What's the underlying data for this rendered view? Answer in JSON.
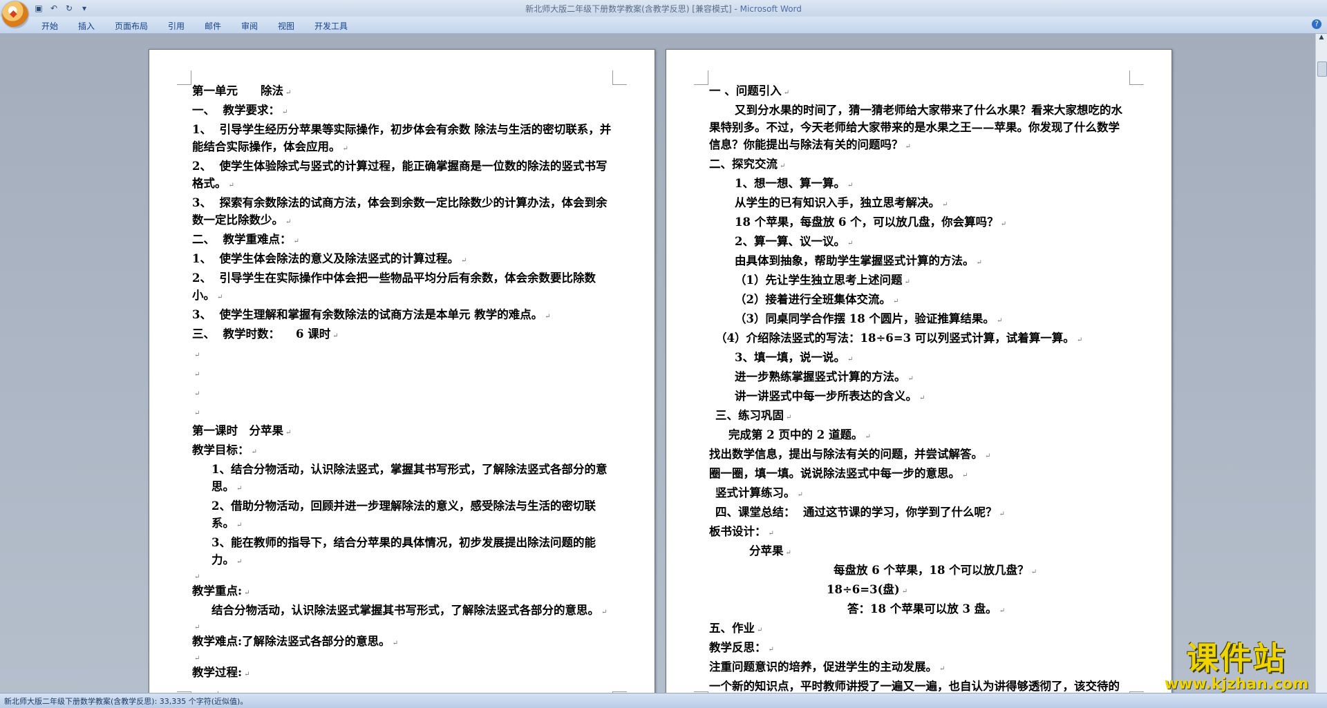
{
  "window": {
    "title": "新北师大版二年级下册数学教案(含教学反思) [兼容模式] - ",
    "app_name": "Microsoft Word"
  },
  "ribbon": {
    "tabs": [
      "开始",
      "插入",
      "页面布局",
      "引用",
      "邮件",
      "审阅",
      "视图",
      "开发工具"
    ]
  },
  "status": {
    "text": "新北师大版二年级下册数学教案(含教学反思): 33,335 个字符(近似值)。"
  },
  "watermark": {
    "text": "课件站",
    "url": "www.kjzhan.com"
  },
  "page1": {
    "lines": [
      "第一单元　　除法",
      "一、  教学要求：",
      "1、  引导学生经历分苹果等实际操作，初步体会有余数 除法与生活的密切联系，并能结合实际操作，体会应用。",
      "2、  使学生体验除式与竖式的计算过程，能正确掌握商是一位数的除法的竖式书写格式。",
      "3、  探索有余数除法的试商方法，体会到余数一定比除数少的计算办法，体会到余数一定比除数少。",
      "二、  教学重难点：",
      "1、  使学生体会除法的意义及除法竖式的计算过程。",
      "2、  引导学生在实际操作中体会把一些物品平均分后有余数，体会余数要比除数小。",
      "3、  使学生理解和掌握有余数除法的试商方法是本单元 教学的难点。",
      "三、  教学时数：    6 课时",
      "",
      "",
      "",
      "",
      "第一课时　分苹果",
      "教学目标：",
      "1、结合分物活动，认识除法竖式，掌握其书写形式，了解除法竖式各部分的意思。",
      "2、借助分物活动，回顾并进一步理解除法的意义，感受除法与生活的密切联系。",
      "3、能在教师的指导下，结合分苹果的具体情况，初步发展提出除法问题的能力。",
      "",
      "教学重点:",
      "结合分物活动，认识除法竖式掌握其书写形式，了解除法竖式各部分的意思。",
      "",
      "教学难点:了解除法竖式各部分的意思。",
      "",
      "教学过程:",
      ""
    ]
  },
  "page2": {
    "lines": [
      "一 、问题引入",
      "又到分水果的时间了，猜一猜老师给大家带来了什么水果？看来大家想吃的水果特别多。不过，今天老师给大家带来的是水果之王——苹果。你发现了什么数学信息？你能提出与除法有关的问题吗？",
      "二、探究交流",
      "1、想一想、算一算。",
      "从学生的已有知识入手，独立思考解决。",
      "18 个苹果，每盘放 6 个，可以放几盘，你会算吗？",
      "2、算一算、议一议。",
      "由具体到抽象，帮助学生掌握竖式计算的方法。",
      "（1）先让学生独立思考上述问题",
      "（2）接着进行全班集体交流。",
      "（3）同桌同学合作摆 18 个圆片，验证推算结果。",
      "（4）介绍除法竖式的写法：18÷6=3 可以列竖式计算，试着算一算。",
      "3、填一填，说一说。",
      "进一步熟练掌握竖式计算的方法。",
      "讲一讲竖式中每一步所表达的含义。",
      "三、练习巩固",
      "完成第 2 页中的 2 道题。",
      "找出数学信息，提出与除法有关的问题，并尝试解答。",
      "圈一圈，填一填。说说除法竖式中每一步的意思。",
      "竖式计算练习。",
      "四、课堂总结：  通过这节课的学习，你学到了什么呢？",
      "板书设计：",
      "分苹果",
      "每盘放 6 个苹果，18 个可以放几盘？",
      "18÷6=3(盘)",
      "答：18 个苹果可以放 3 盘。",
      "五、作业",
      "教学反思：",
      "注重问题意识的培养，促进学生的主动发展。",
      "一个新的知识点，平时教师讲授了一遍又一遍，也自认为讲得够透彻了，该交待的该提醒的也都有了，学生也似乎在自身形成概念了，基本上知道什么是对的，什么是错的，但为什么有些学生做题时又会出现这样那样的"
    ]
  }
}
